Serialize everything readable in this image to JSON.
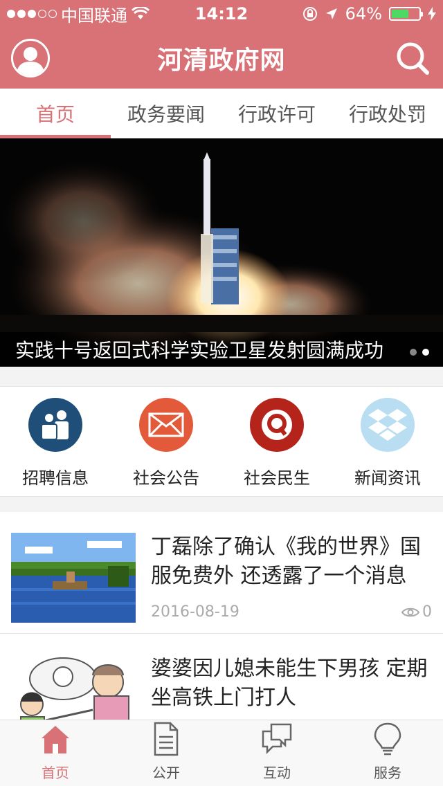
{
  "status_bar": {
    "carrier": "中国联通",
    "time": "14:12",
    "battery_percent": "64%",
    "battery_level": 0.64
  },
  "header": {
    "title": "河清政府网"
  },
  "tabs": [
    {
      "label": "首页",
      "active": true
    },
    {
      "label": "政务要闻",
      "active": false
    },
    {
      "label": "行政许可",
      "active": false
    },
    {
      "label": "行政处罚",
      "active": false
    }
  ],
  "banner": {
    "caption": "实践十号返回式科学实验卫星发射圆满成功"
  },
  "quick_links": [
    {
      "label": "招聘信息",
      "color": "#1f4e79",
      "icon": "people-icon"
    },
    {
      "label": "社会公告",
      "color": "#e25a3a",
      "icon": "mail-icon"
    },
    {
      "label": "社会民生",
      "color": "#b4241b",
      "icon": "q-icon"
    },
    {
      "label": "新闻资讯",
      "color": "#b9def1",
      "icon": "dropbox-icon"
    }
  ],
  "news": [
    {
      "title": "丁磊除了确认《我的世界》国服免费外 还透露了一个消息",
      "date": "2016-08-19",
      "views": "0"
    },
    {
      "title": "婆婆因儿媳未能生下男孩 定期坐高铁上门打人",
      "date": "",
      "views": ""
    }
  ],
  "bottom_nav": [
    {
      "label": "首页",
      "active": true
    },
    {
      "label": "公开",
      "active": false
    },
    {
      "label": "互动",
      "active": false
    },
    {
      "label": "服务",
      "active": false
    }
  ],
  "colors": {
    "brand": "#d87276"
  }
}
